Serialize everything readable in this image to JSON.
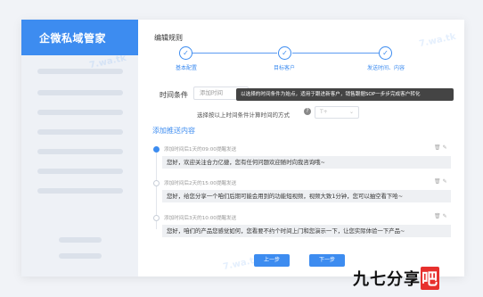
{
  "sidebar": {
    "brand": "企微私域管家"
  },
  "page": {
    "title": "编辑规则"
  },
  "steps": [
    {
      "label": "基本配置",
      "icon": "check-icon"
    },
    {
      "label": "目标客户",
      "icon": "check-icon"
    },
    {
      "label": "发送时间、内容",
      "icon": "check-icon"
    }
  ],
  "condition": {
    "label": "时间条件",
    "placeholder": "添加时间",
    "tooltip": "以选择的时间条件为始点，适用于跟进新客户，销售跟据SOP一步步完成客户转化",
    "method_label": "选择按以上时间条件计算时间的方式",
    "method_value": "T+"
  },
  "section": {
    "title": "添加推送内容"
  },
  "timeline": [
    {
      "time": "添加时间后1天的09:00提醒发送",
      "text": "您好，欢迎关注合力亿捷，您有任何问题欢迎随时向我咨询哦~"
    },
    {
      "time": "添加时间后2天的15:00提醒发送",
      "text": "您好，给您分享一个咱们后期可能会用到的功能短视频，视频大致1分钟，您可以抽空看下哈~"
    },
    {
      "time": "添加时间后3天的10:00提醒发送",
      "text": "您好，咱们的产品您感觉如何，您看要不约个时间上门和您演示一下，让您实际体验一下产品~"
    }
  ],
  "buttons": {
    "prev": "上一步",
    "next": "下一步"
  },
  "watermark": "7.wa.tk",
  "logo": {
    "main": "九七分享",
    "accent": "吧"
  },
  "colors": {
    "accent": "#3d8cf0",
    "logo_accent": "#e7302d"
  }
}
